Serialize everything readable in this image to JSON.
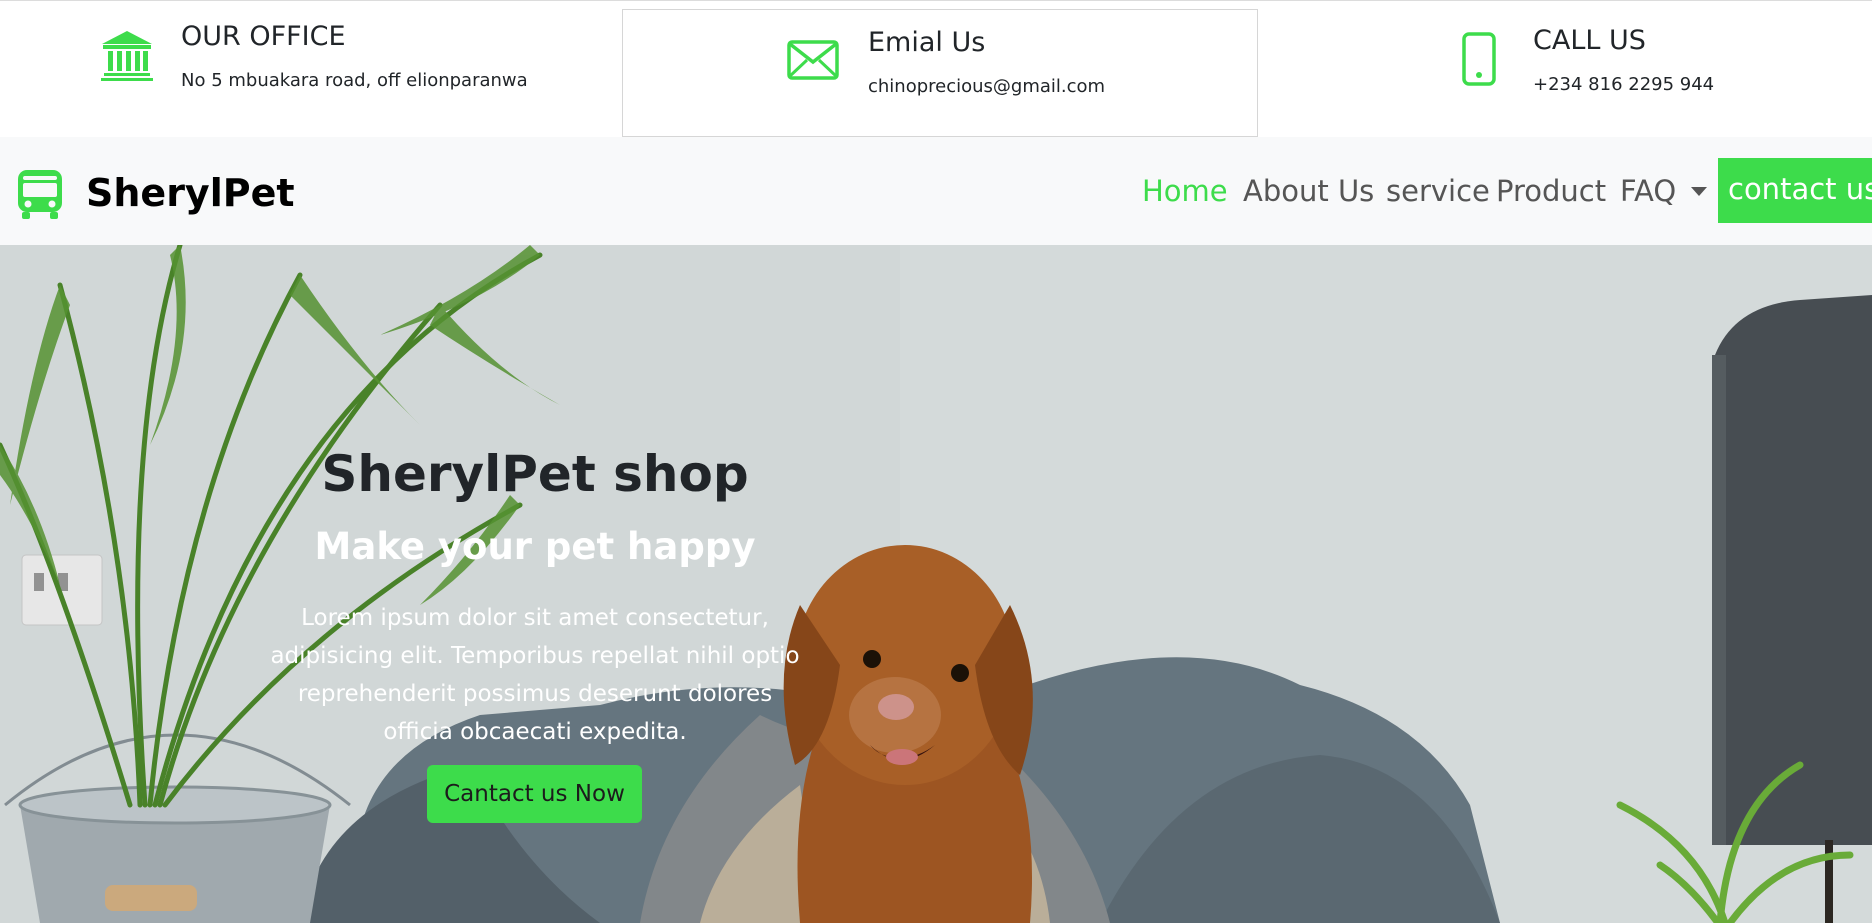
{
  "colors": {
    "accent": "#3ddc4b",
    "nav_text": "#555555",
    "navbar_bg": "#f8f9fa",
    "text_dark": "#212529"
  },
  "contact_info": [
    {
      "icon": "bank-icon",
      "title": "OUR OFFICE",
      "detail": "No 5 mbuakara road, off elionparanwa"
    },
    {
      "icon": "envelope-icon",
      "title": "Emial Us",
      "detail": "chinoprecious@gmail.com"
    },
    {
      "icon": "phone-icon",
      "title": "CALL US",
      "detail": "+234 816 2295 944"
    }
  ],
  "navbar": {
    "brand_icon": "bus-icon",
    "brand": "SherylPet",
    "links": [
      {
        "label": "Home",
        "active": true
      },
      {
        "label": "About Us",
        "active": false
      },
      {
        "label": "service",
        "active": false
      },
      {
        "label": "Product",
        "active": false
      },
      {
        "label": "FAQ",
        "active": false,
        "dropdown": true
      }
    ],
    "cta": "contact us"
  },
  "hero": {
    "title": "SherylPet shop",
    "subtitle": "Make your pet happy",
    "text": "Lorem ipsum dolor sit amet consectetur, adipisicing elit. Temporibus repellat nihil optio reprehenderit possimus deserunt dolores officia obcaecati expedita.",
    "button": "Cantact us Now"
  }
}
